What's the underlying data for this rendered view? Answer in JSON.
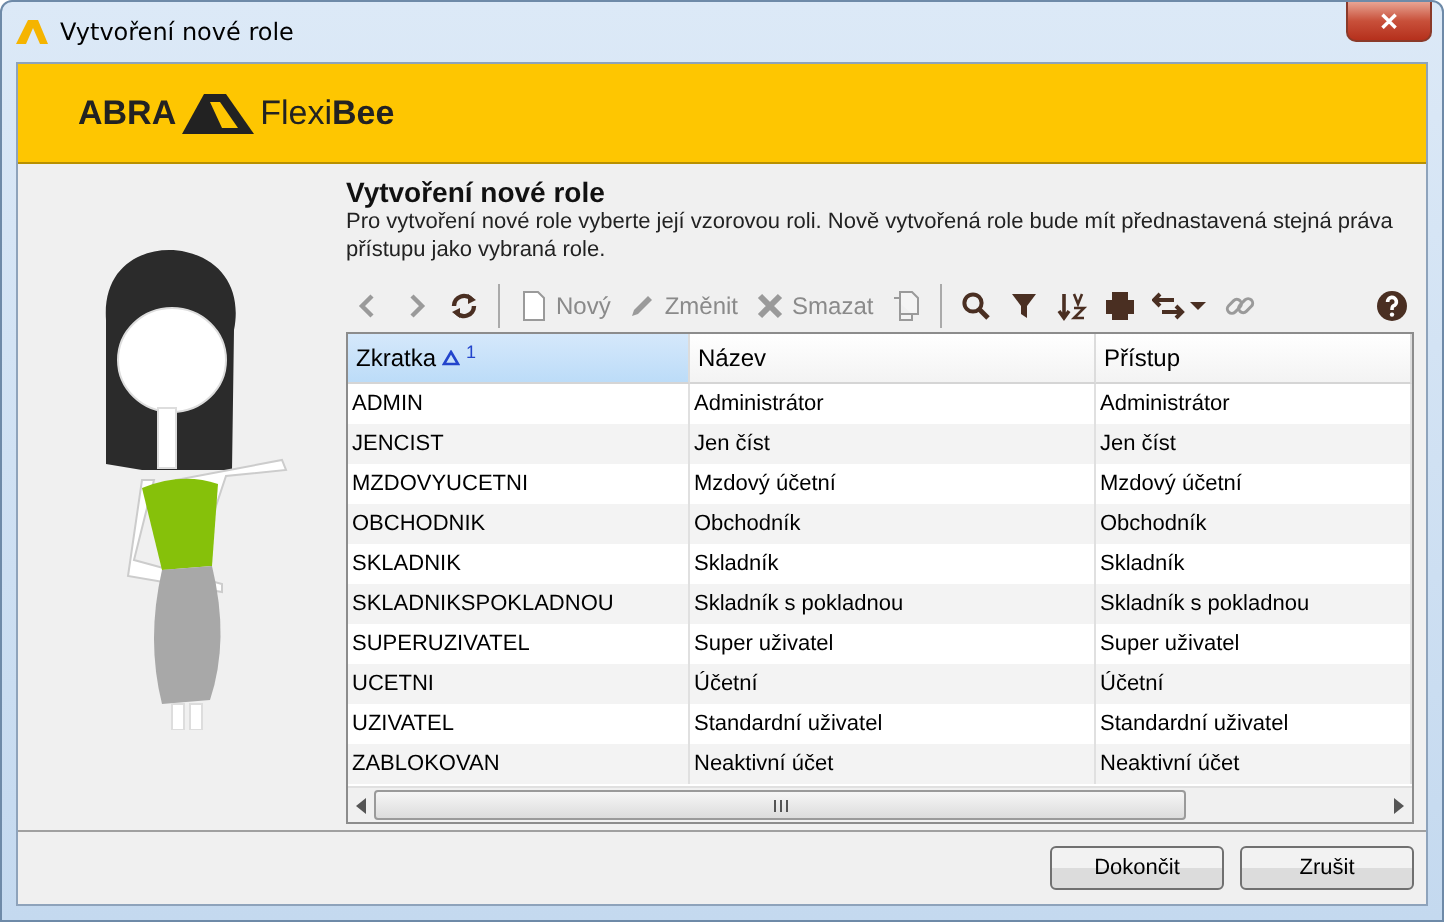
{
  "window": {
    "title": "Vytvoření nové role",
    "close": "✕"
  },
  "header": {
    "brand_left": "ABRA",
    "brand_right": "Flexi**Bee**"
  },
  "heading": "Vytvoření nové role",
  "description": "Pro vytvoření nové role vyberte její vzorovou roli. Nově vytvořená role bude mít přednastavená stejná práva přístupu jako vybraná role.",
  "toolbar": [
    {
      "kind": "icon",
      "disabled": true
    },
    {
      "kind": "icon",
      "disabled": true
    },
    {
      "kind": "icon",
      "disabled": false
    },
    {
      "kind": "separator"
    },
    {
      "kind": "text",
      "label": "Nový",
      "disabled": true
    },
    {
      "kind": "text",
      "label": "Změnit",
      "disabled": true
    },
    {
      "kind": "text",
      "label": "Smazat",
      "disabled": true
    },
    {
      "kind": "icon",
      "disabled": true
    },
    {
      "kind": "separator"
    },
    {
      "kind": "icon",
      "disabled": false
    },
    {
      "kind": "icon",
      "disabled": false
    },
    {
      "kind": "icon",
      "disabled": false
    },
    {
      "kind": "icon",
      "disabled": false
    },
    {
      "kind": "icon",
      "disabled": false
    },
    {
      "kind": "icon",
      "disabled": true
    },
    {
      "kind": "spacer"
    },
    {
      "kind": "icon",
      "disabled": false
    }
  ],
  "table": {
    "columns": [
      {
        "label": "Zkratka",
        "selected": true,
        "sorted_ascending": true,
        "sort_order": "1"
      },
      {
        "label": "Název",
        "selected": false
      },
      {
        "label": "Přístup",
        "selected": false
      }
    ],
    "rows": [
      [
        "ADMIN",
        "Administrátor",
        "Administrátor"
      ],
      [
        "JENCIST",
        "Jen číst",
        "Jen číst"
      ],
      [
        "MZDOVYUCETNI",
        "Mzdový účetní",
        "Mzdový účetní"
      ],
      [
        "OBCHODNIK",
        "Obchodník",
        "Obchodník"
      ],
      [
        "SKLADNIK",
        "Skladník",
        "Skladník"
      ],
      [
        "SKLADNIKSPOKLADNOU",
        "Skladník s pokladnou",
        "Skladník s pokladnou"
      ],
      [
        "SUPERUZIVATEL",
        "Super uživatel",
        "Super uživatel"
      ],
      [
        "UCETNI",
        "Účetní",
        "Účetní"
      ],
      [
        "UZIVATEL",
        "Standardní uživatel",
        "Standardní uživatel"
      ],
      [
        "ZABLOKOVAN",
        "Neaktivní účet",
        "Neaktivní účet"
      ]
    ]
  },
  "buttons": [
    "Dokončit",
    "Zrušit"
  ]
}
